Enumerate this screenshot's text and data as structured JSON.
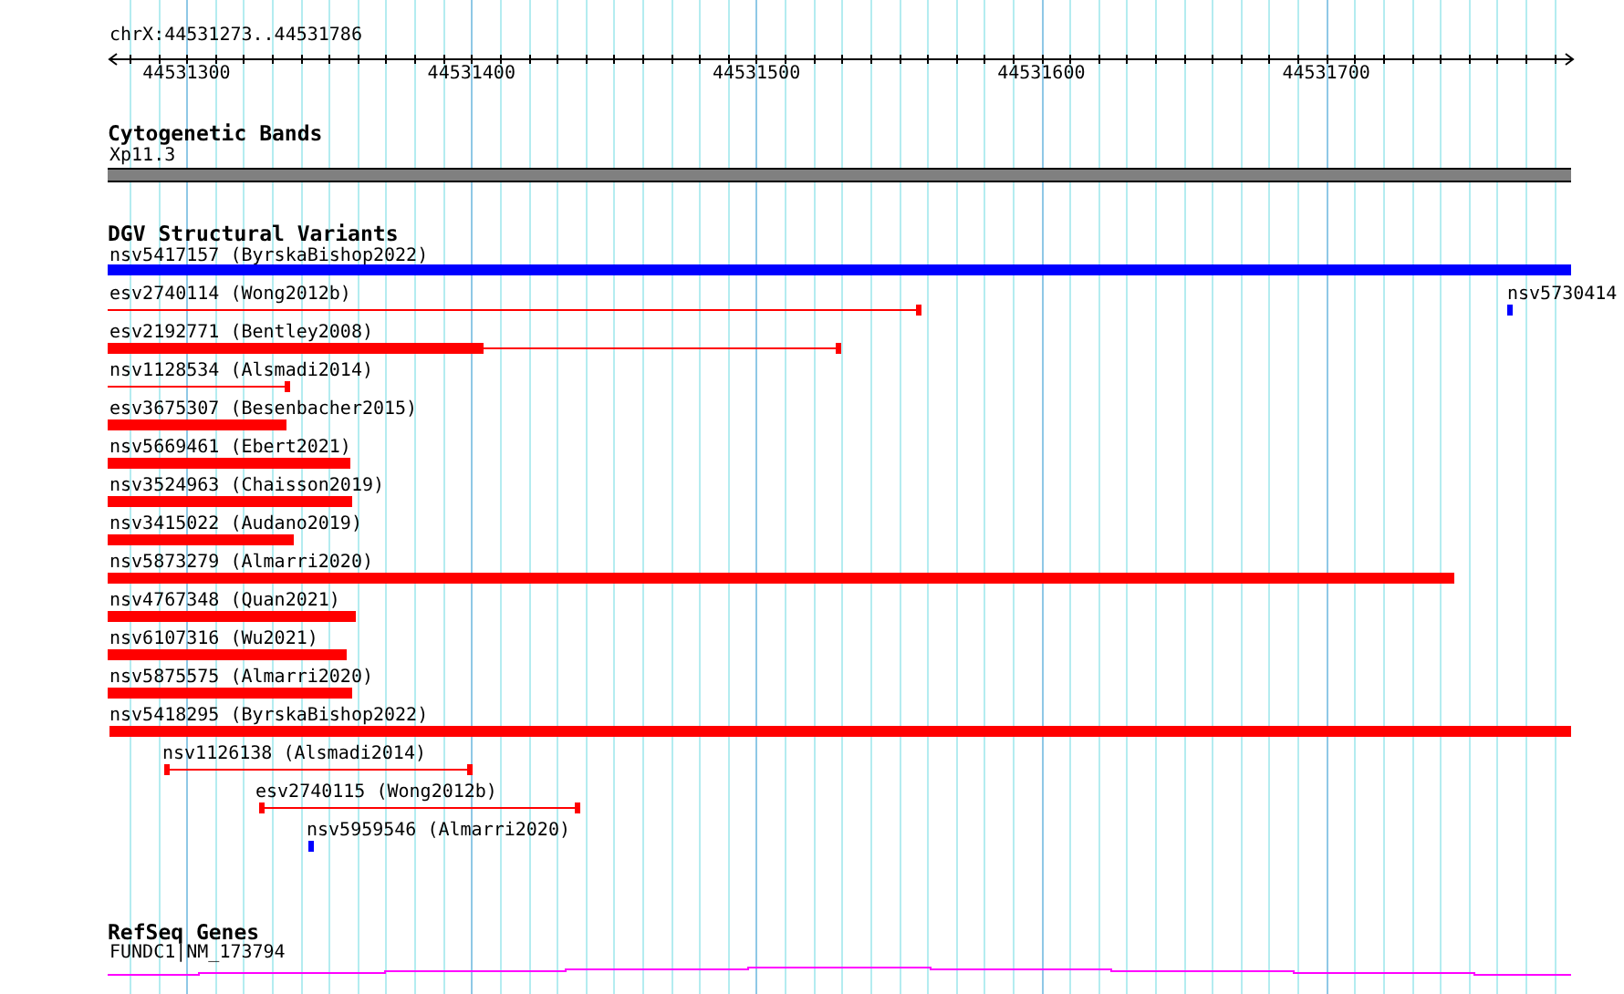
{
  "ruler": {
    "region": "chrX:44531273..44531786",
    "labels": [
      "44531300",
      "44531400",
      "44531500",
      "44531600",
      "44531700"
    ]
  },
  "tracks": [
    {
      "kind": "cytoband",
      "title": "Cytogenetic Bands",
      "features": [
        {
          "label": "Xp11.3"
        }
      ]
    },
    {
      "kind": "variants",
      "title": "DGV Structural Variants",
      "features": [
        {
          "label": "nsv5417157 (ByrskaBishop2022)",
          "kind": "block",
          "color": "#0000ff"
        },
        {
          "label": "esv2740114 (Wong2012b)",
          "kind": "line",
          "color": "#ff0000"
        },
        {
          "label": "nsv5730414",
          "kind": "block",
          "color": "#0000ff"
        },
        {
          "label": "esv2192771 (Bentley2008)",
          "kind": "split",
          "color": "#ff0000"
        },
        {
          "label": "nsv1128534 (Alsmadi2014)",
          "kind": "line",
          "color": "#ff0000"
        },
        {
          "label": "esv3675307 (Besenbacher2015)",
          "kind": "block",
          "color": "#ff0000"
        },
        {
          "label": "nsv5669461 (Ebert2021)",
          "kind": "block",
          "color": "#ff0000"
        },
        {
          "label": "nsv3524963 (Chaisson2019)",
          "kind": "block",
          "color": "#ff0000"
        },
        {
          "label": "nsv3415022 (Audano2019)",
          "kind": "block",
          "color": "#ff0000"
        },
        {
          "label": "nsv5873279 (Almarri2020)",
          "kind": "block",
          "color": "#ff0000"
        },
        {
          "label": "nsv4767348 (Quan2021)",
          "kind": "block",
          "color": "#ff0000"
        },
        {
          "label": "nsv6107316 (Wu2021)",
          "kind": "block",
          "color": "#ff0000"
        },
        {
          "label": "nsv5875575 (Almarri2020)",
          "kind": "block",
          "color": "#ff0000"
        },
        {
          "label": "nsv5418295 (ByrskaBishop2022)",
          "kind": "block",
          "color": "#ff0000"
        },
        {
          "label": "nsv1126138 (Alsmadi2014)",
          "kind": "line",
          "color": "#ff0000"
        },
        {
          "label": "esv2740115 (Wong2012b)",
          "kind": "line",
          "color": "#ff0000"
        },
        {
          "label": "nsv5959546 (Almarri2020)",
          "kind": "block",
          "color": "#0000ff"
        }
      ]
    },
    {
      "kind": "genes",
      "title": "RefSeq Genes",
      "features": [
        {
          "label": "FUNDC1|NM_173794"
        }
      ]
    }
  ]
}
